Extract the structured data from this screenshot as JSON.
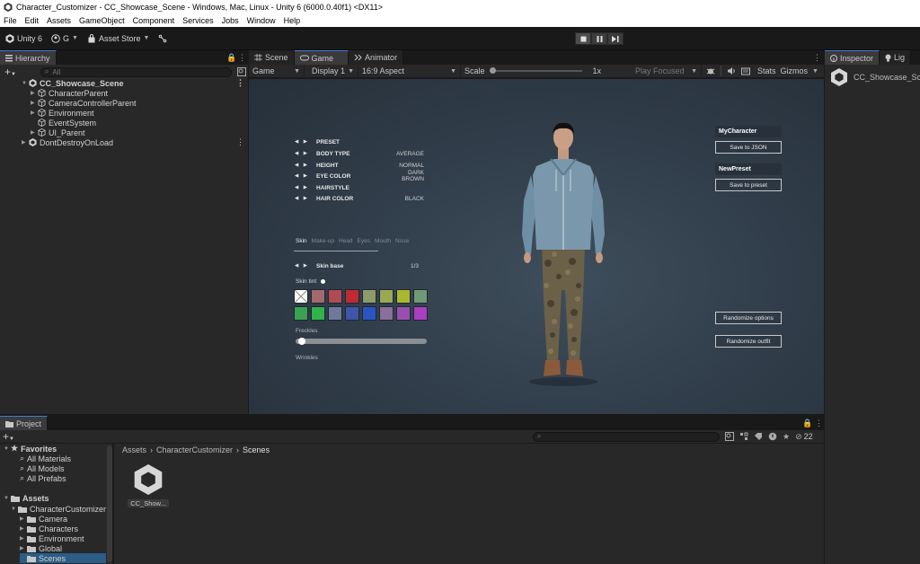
{
  "window": {
    "title": "Character_Customizer - CC_Showcase_Scene - Windows, Mac, Linux - Unity 6 (6000.0.40f1) <DX11>"
  },
  "menu": [
    "File",
    "Edit",
    "Assets",
    "GameObject",
    "Component",
    "Services",
    "Jobs",
    "Window",
    "Help"
  ],
  "toolbar": {
    "brand": "Unity 6",
    "account": "G",
    "asset_store": "Asset Store"
  },
  "hierarchy": {
    "tab": "Hierarchy",
    "search_placeholder": "All",
    "scene": "CC_Showcase_Scene",
    "items": [
      "CharacterParent",
      "CameraControllerParent",
      "Environment",
      "EventSystem",
      "UI_Parent"
    ],
    "dontdestroy": "DontDestroyOnLoad"
  },
  "center_tabs": [
    "Scene",
    "Game",
    "Animator"
  ],
  "game_toolbar": {
    "mode": "Game",
    "display": "Display 1",
    "aspect": "16:9 Aspect",
    "scale_label": "Scale",
    "scale_value": "1x",
    "play_focused": "Play Focused",
    "stats": "Stats",
    "gizmos": "Gizmos"
  },
  "customizer": {
    "options": [
      {
        "label": "PRESET",
        "value": ""
      },
      {
        "label": "BODY TYPE",
        "value": "AVERAGE"
      },
      {
        "label": "HEIGHT",
        "value": "NORMAL"
      },
      {
        "label": "EYE COLOR",
        "value": "DARK BROWN"
      },
      {
        "label": "HAIRSTYLE",
        "value": ""
      },
      {
        "label": "HAIR COLOR",
        "value": "BLACK"
      }
    ],
    "categories": [
      "Skin",
      "Make-up",
      "Head",
      "Eyes",
      "Mouth",
      "Nose"
    ],
    "skin_base_label": "Skin base",
    "skin_base_value": "1/3",
    "skin_tint_label": "Skin tint",
    "swatches": [
      "#ffffff",
      "#a36a6e",
      "#b04a55",
      "#c02a35",
      "#8f9a6a",
      "#9aa855",
      "#a9b82e",
      "#6f9a76",
      "#3aa052",
      "#2fb34a",
      "#6f7a9a",
      "#3f55a8",
      "#2a55c0",
      "#8a6f9a",
      "#9a4fb0",
      "#a93ec0"
    ],
    "freckles_label": "Freckles",
    "freckles_value": 0.02,
    "wrinkles_label": "Wrinkles",
    "my_character": "MyCharacter",
    "save_json": "Save to JSON",
    "new_preset": "NewPreset",
    "save_preset": "Save to preset",
    "randomize_options": "Randomize options",
    "randomize_outfit": "Randomize outfit"
  },
  "inspector": {
    "tabs": [
      "Inspector",
      "Lig"
    ],
    "object": "CC_Showcase_Sc"
  },
  "project": {
    "tab": "Project",
    "breadcrumb": [
      "Assets",
      "CharacterCustomizer",
      "Scenes"
    ],
    "count": "22",
    "favorites": "Favorites",
    "fav_items": [
      "All Materials",
      "All Models",
      "All Prefabs"
    ],
    "assets": "Assets",
    "cc_folder": "CharacterCustomizer",
    "subfolders": [
      "Camera",
      "Characters",
      "Environment",
      "Global",
      "Scenes"
    ],
    "asset_file": "CC_Show..."
  },
  "colors": {
    "accent": "#3e7bd6",
    "panel": "#282828",
    "selected": "#2c5d87"
  }
}
